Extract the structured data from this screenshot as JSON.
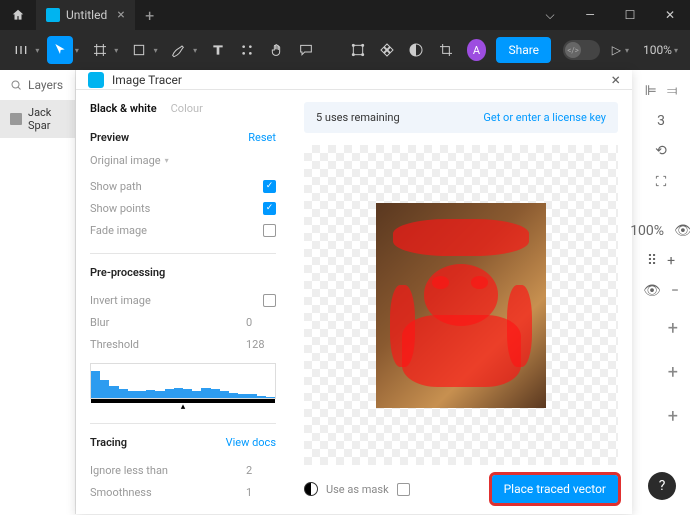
{
  "tab": {
    "title": "Untitled"
  },
  "toolbar": {
    "avatar": "A",
    "share": "Share",
    "zoom": "100%"
  },
  "layers": {
    "header": "Layers",
    "item0": "Jack Spar"
  },
  "panel": {
    "title": "Image Tracer"
  },
  "modes": {
    "bw": "Black & white",
    "colour": "Colour"
  },
  "preview": {
    "title": "Preview",
    "reset": "Reset",
    "original": "Original image",
    "show_path": "Show path",
    "show_points": "Show points",
    "fade": "Fade image"
  },
  "preproc": {
    "title": "Pre-processing",
    "invert": "Invert image",
    "blur": "Blur",
    "blur_v": "0",
    "threshold": "Threshold",
    "threshold_v": "128"
  },
  "tracing": {
    "title": "Tracing",
    "docs": "View docs",
    "ignore": "Ignore less than",
    "ignore_v": "2",
    "smooth": "Smoothness",
    "smooth_v": "1"
  },
  "license": {
    "remaining": "5 uses remaining",
    "get": "Get or enter a license key"
  },
  "footer": {
    "mask": "Use as mask",
    "place": "Place traced vector"
  },
  "right": {
    "pct": "100%",
    "val": "3"
  }
}
